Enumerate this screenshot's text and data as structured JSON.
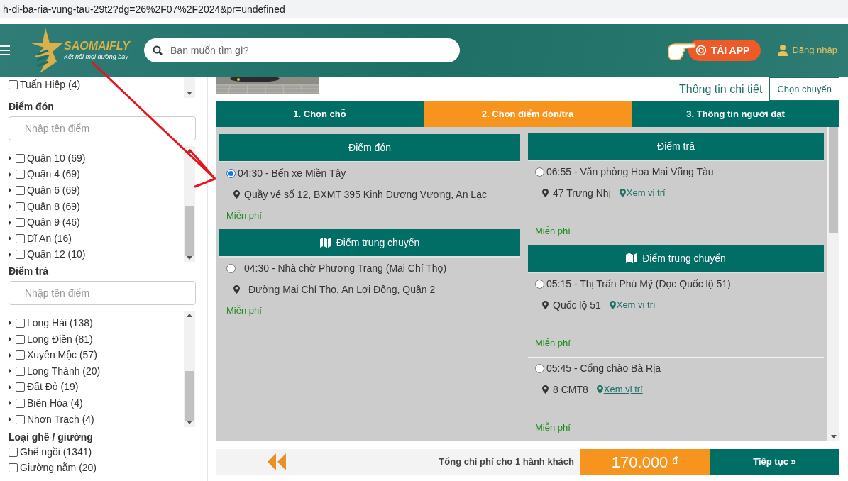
{
  "url": "h-di-ba-ria-vung-tau-29t2?dg=26%2F07%2F2024&pr=undefined",
  "header": {
    "logo_name": "SAOMAIFLY",
    "logo_tagline": "Kết nối mọi đường bay",
    "search_placeholder": "Bạn muốn tìm gì?",
    "app_button": "TẢI APP",
    "login": "Đăng nhập"
  },
  "sidebar": {
    "operators": [
      {
        "label": "Tuấn Hiệp (4)",
        "checked": false
      }
    ],
    "pickup_filter": {
      "title": "Điểm đón",
      "placeholder": "Nhập tên điểm",
      "items": [
        {
          "label": "Quận 10 (69)",
          "checked": false
        },
        {
          "label": "Quận 4 (69)",
          "checked": false
        },
        {
          "label": "Quận 6 (69)",
          "checked": false
        },
        {
          "label": "Quận 8 (69)",
          "checked": false
        },
        {
          "label": "Quận 9 (46)",
          "checked": false
        },
        {
          "label": "Dĩ An (16)",
          "checked": false
        },
        {
          "label": "Quận 12 (10)",
          "checked": false
        }
      ]
    },
    "dropoff_filter": {
      "title": "Điểm trả",
      "placeholder": "Nhập tên điểm",
      "items": [
        {
          "label": "Long Hải (138)",
          "checked": false
        },
        {
          "label": "Long Điền (81)",
          "checked": false
        },
        {
          "label": "Xuyên Mộc (57)",
          "checked": false
        },
        {
          "label": "Long Thành (20)",
          "checked": false
        },
        {
          "label": "Đất Đỏ (19)",
          "checked": false
        },
        {
          "label": "Biên Hòa (4)",
          "checked": false
        },
        {
          "label": "Nhơn Trạch (4)",
          "checked": false
        }
      ]
    },
    "seat_type": {
      "title": "Loại ghế / giường",
      "items": [
        {
          "label": "Ghế ngồi (1341)",
          "checked": false
        },
        {
          "label": "Giường nằm (20)",
          "checked": false
        }
      ]
    }
  },
  "trip": {
    "details_link": "Thông tin chi tiết",
    "choose_button": "Chọn chuyến"
  },
  "steps": [
    {
      "label": "1. Chọn chỗ",
      "selected": false
    },
    {
      "label": "2. Chọn điểm đón/trả",
      "selected": true
    },
    {
      "label": "3. Thông tin người đặt",
      "selected": false
    }
  ],
  "pickup": {
    "title": "Điểm đón",
    "options": [
      {
        "name": "04:30 - Bến xe Miền Tây",
        "address": "Quầy vé số 12, BXMT 395 Kinh Dương Vương, An Lạc",
        "price": "Miễn phí",
        "selected": true
      }
    ],
    "transfer_title": "Điểm trung chuyển",
    "transfer_options": [
      {
        "name": "04:30 - Nhà chờ Phương Trang (Mai Chí Thọ)",
        "address": "Đường Mai Chí Thọ, An Lợi Đông, Quận 2",
        "price": "Miễn phí",
        "selected": false
      }
    ]
  },
  "dropoff": {
    "title": "Điểm trả",
    "options": [
      {
        "name": "06:55 - Văn phòng Hoa Mai Vũng Tàu",
        "address": "47 Trưng Nhị",
        "map_link": "Xem vị trí",
        "price": "Miễn phí",
        "selected": false
      }
    ],
    "transfer_title": "Điểm trung chuyển",
    "transfer_options": [
      {
        "name": "05:15 - Thị Trấn Phú Mỹ (Dọc Quốc lộ 51)",
        "address": "Quốc lộ 51",
        "map_link": "Xem vị trí",
        "price": "Miễn phí",
        "selected": false
      },
      {
        "name": "05:45 - Cổng chào Bà Rịa",
        "address": "8 CMT8",
        "map_link": "Xem vị trí",
        "price": "Miễn phí",
        "selected": false
      }
    ]
  },
  "footer": {
    "total_label": "Tổng chi phí cho 1 hành khách",
    "price": "170.000",
    "currency": "đ",
    "continue_button": "Tiếp tục »"
  }
}
